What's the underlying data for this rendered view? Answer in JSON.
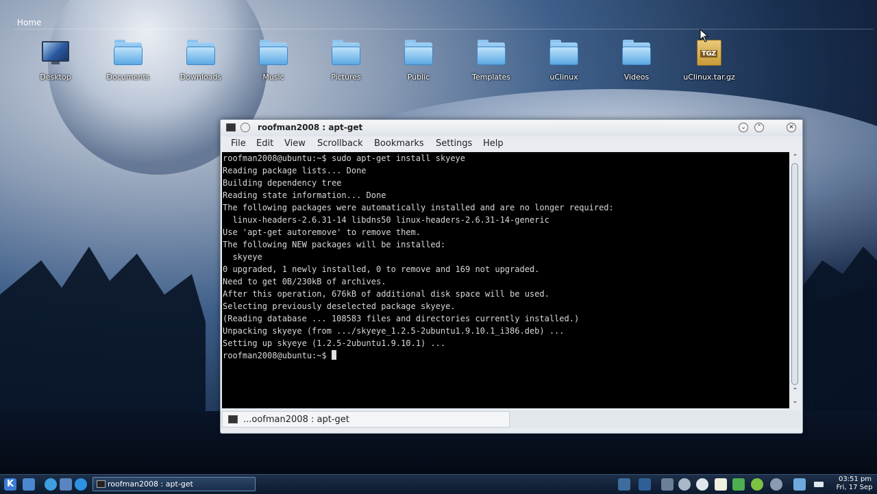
{
  "desktop": {
    "title": "Home",
    "icons": [
      {
        "label": "Desktop",
        "icon": "desktop-monitor-icon"
      },
      {
        "label": "Documents",
        "icon": "folder-icon"
      },
      {
        "label": "Downloads",
        "icon": "folder-icon"
      },
      {
        "label": "Music",
        "icon": "folder-icon"
      },
      {
        "label": "Pictures",
        "icon": "folder-icon"
      },
      {
        "label": "Public",
        "icon": "folder-icon"
      },
      {
        "label": "Templates",
        "icon": "folder-icon"
      },
      {
        "label": "uClinux",
        "icon": "folder-icon"
      },
      {
        "label": "Videos",
        "icon": "folder-icon"
      },
      {
        "label": "uClinux.tar.gz",
        "icon": "archive-icon",
        "badge": "TGZ"
      }
    ]
  },
  "window": {
    "title": "roofman2008 : apt-get",
    "menu": [
      "File",
      "Edit",
      "View",
      "Scrollback",
      "Bookmarks",
      "Settings",
      "Help"
    ],
    "terminal_lines": [
      "roofman2008@ubuntu:~$ sudo apt-get install skyeye",
      "Reading package lists... Done",
      "Building dependency tree",
      "Reading state information... Done",
      "The following packages were automatically installed and are no longer required:",
      "  linux-headers-2.6.31-14 libdns50 linux-headers-2.6.31-14-generic",
      "Use 'apt-get autoremove' to remove them.",
      "The following NEW packages will be installed:",
      "  skyeye",
      "0 upgraded, 1 newly installed, 0 to remove and 169 not upgraded.",
      "Need to get 0B/230kB of archives.",
      "After this operation, 676kB of additional disk space will be used.",
      "Selecting previously deselected package skyeye.",
      "(Reading database ... 108583 files and directories currently installed.)",
      "Unpacking skyeye (from .../skyeye_1.2.5-2ubuntu1.9.10.1_i386.deb) ...",
      "Setting up skyeye (1.2.5-2ubuntu1.9.10.1) ...",
      "roofman2008@ubuntu:~$ "
    ],
    "tab_label": "...oofman2008 : apt-get"
  },
  "taskbar": {
    "task_label": "roofman2008 : apt-get",
    "clock_time": "03:51 pm",
    "clock_date": "Fri, 17 Sep"
  }
}
